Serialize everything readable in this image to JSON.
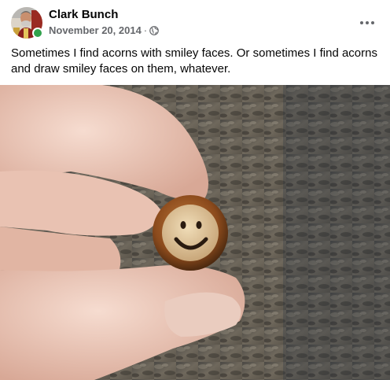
{
  "post": {
    "author": "Clark Bunch",
    "date": "November 20, 2014",
    "separator": "·",
    "audience_icon": "globe-icon",
    "more_icon": "more-options-icon",
    "caption": "Sometimes I find acorns with smiley faces. Or sometimes I find acorns and draw smiley faces on them, whatever.",
    "online_status_color": "#31a24c",
    "photo_subject": "acorn-with-smiley-face-photo"
  }
}
